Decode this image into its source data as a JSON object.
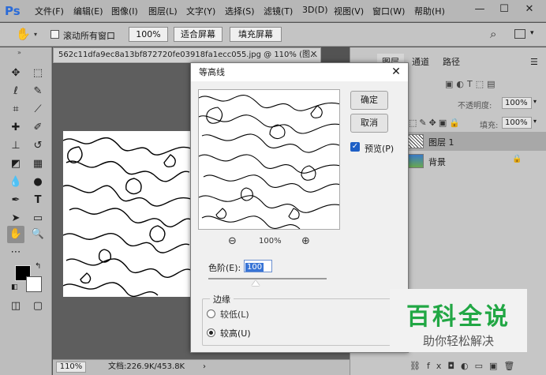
{
  "app": {
    "logo": "Ps",
    "menu": [
      "文件(F)",
      "编辑(E)",
      "图像(I)",
      "图层(L)",
      "文字(Y)",
      "选择(S)",
      "滤镜(T)",
      "3D(D)",
      "视图(V)",
      "窗口(W)",
      "帮助(H)"
    ],
    "window_controls": [
      "—",
      "☐",
      "✕"
    ]
  },
  "options_bar": {
    "scroll_all_label": "滚动所有窗口",
    "zoom_value": "100%",
    "fit_screen": "适合屏幕",
    "fill_screen": "填充屏幕"
  },
  "document": {
    "tab_title": "562c11dfa9ec8a13bf872720fe03918fa1ecc055.jpg @ 110% (图...",
    "zoom": "110%",
    "doc_size": "文档:226.9K/453.8K"
  },
  "panels": {
    "tabs": [
      "图层",
      "通道",
      "路径"
    ],
    "opacity_label": "不透明度:",
    "opacity_value": "100%",
    "fill_label": "填充:",
    "fill_value": "100%",
    "layers": [
      {
        "name": "图层 1",
        "selected": true
      },
      {
        "name": "背景",
        "locked": true
      }
    ]
  },
  "dialog": {
    "title": "等高线",
    "ok": "确定",
    "cancel": "取消",
    "preview_label": "预览(P)",
    "preview_checked": true,
    "preview_zoom": "100%",
    "level_label": "色阶(E):",
    "level_value": "100",
    "level_fraction": 0.4,
    "edge_group": "边缘",
    "edge_options": [
      "较低(L)",
      "较高(U)"
    ],
    "edge_selected": 1
  },
  "watermark": {
    "title": "百科全说",
    "subtitle": "助你轻松解决"
  },
  "colors": {
    "accent": "#2a6bd8",
    "watermark_green": "#21a744"
  }
}
